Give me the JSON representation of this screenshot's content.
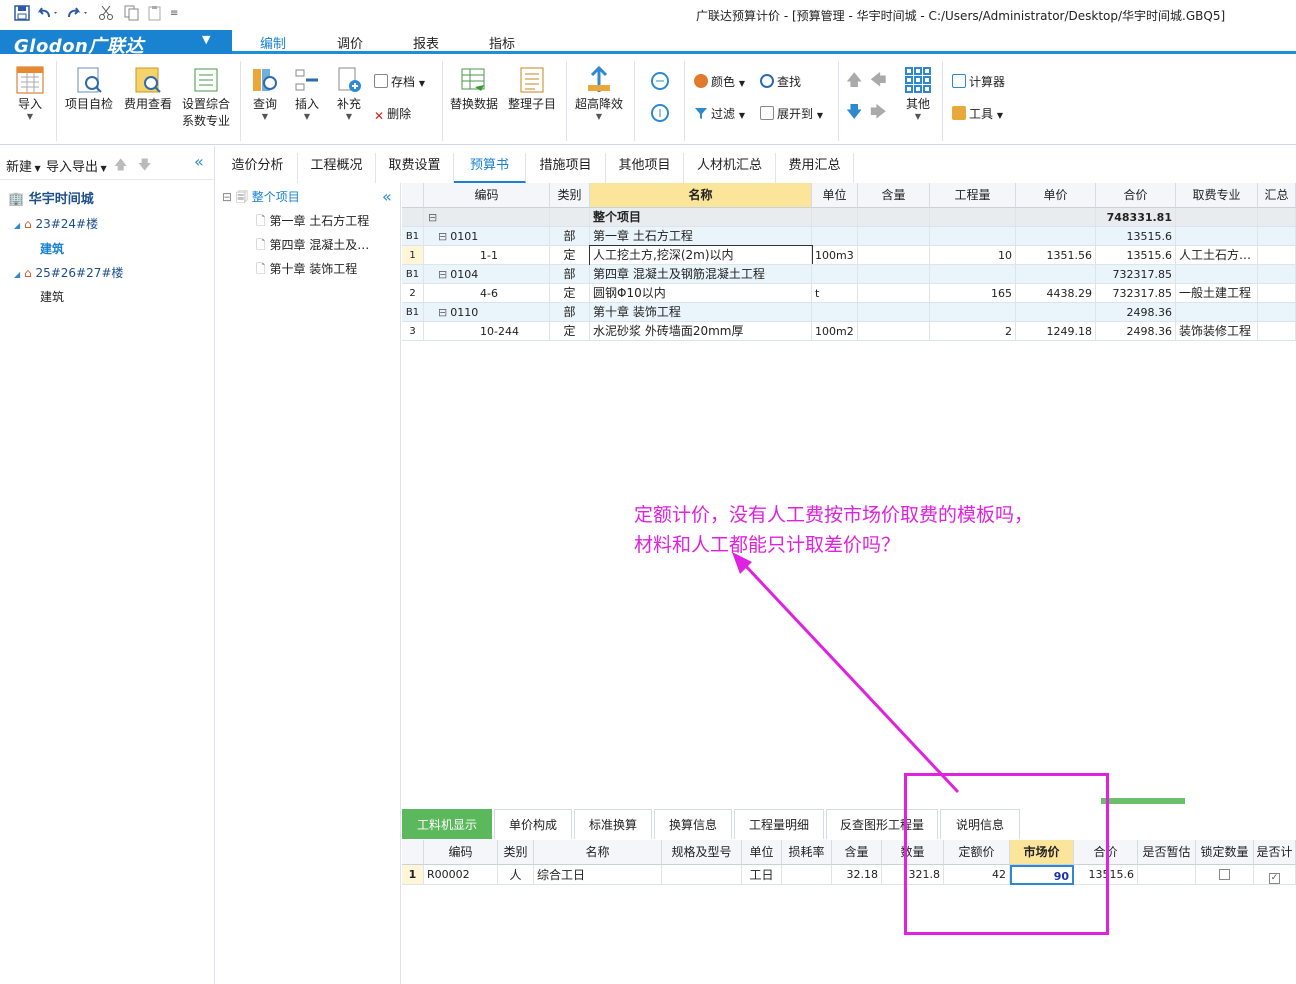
{
  "window": {
    "title": "广联达预算计价 - [预算管理 - 华宇时间城 - C:/Users/Administrator/Desktop/华宇时间城.GBQ5]"
  },
  "brand": {
    "logo": "Glodon广联达",
    "caret": "▼"
  },
  "menu": {
    "tabs": [
      "编制",
      "调价",
      "报表",
      "指标"
    ],
    "active": "编制"
  },
  "ribbon": {
    "import": "导入",
    "self_check": "项目自检",
    "fee_view": "费用查看",
    "set_coeff_line1": "设置综合",
    "set_coeff_line2": "系数专业",
    "query": "查询",
    "insert": "插入",
    "supplement": "补充",
    "save_file": "存档",
    "delete": "删除",
    "replace_data": "替换数据",
    "organize": "整理子目",
    "super_high": "超高降效",
    "color": "颜色",
    "find": "查找",
    "filter": "过滤",
    "expand_to": "展开到",
    "other": "其他",
    "calculator": "计算器",
    "tools": "工具"
  },
  "left": {
    "new": "新建",
    "import_export": "导入导出",
    "project": "华宇时间城",
    "buildings": [
      {
        "name": "23#24#楼",
        "child": "建筑"
      },
      {
        "name": "25#26#27#楼",
        "child": "建筑"
      }
    ]
  },
  "mid": {
    "root": "整个项目",
    "items": [
      "第一章 土石方工程",
      "第四章 混凝土及…",
      "第十章 装饰工程"
    ]
  },
  "content_tabs": [
    "造价分析",
    "工程概况",
    "取费设置",
    "预算书",
    "措施项目",
    "其他项目",
    "人材机汇总",
    "费用汇总"
  ],
  "content_tab_active": "预算书",
  "grid": {
    "headers": [
      "编码",
      "类别",
      "名称",
      "单位",
      "含量",
      "工程量",
      "单价",
      "合价",
      "取费专业",
      "汇总"
    ],
    "rows": [
      {
        "no": "",
        "code": "",
        "type": "",
        "name": "整个项目",
        "unit": "",
        "qty": "",
        "price": "",
        "total": "748331.81",
        "fee": "",
        "kind": "root"
      },
      {
        "no": "B1",
        "code": "0101",
        "type": "部",
        "name": "第一章 土石方工程",
        "unit": "",
        "qty": "",
        "price": "",
        "total": "13515.6",
        "fee": "",
        "kind": "part"
      },
      {
        "no": "1",
        "code": "1-1",
        "type": "定",
        "name": "人工挖土方,挖深(2m)以内",
        "unit": "100m3",
        "qty": "10",
        "price": "1351.56",
        "total": "13515.6",
        "fee": "人工土石方…",
        "kind": "item"
      },
      {
        "no": "B1",
        "code": "0104",
        "type": "部",
        "name": "第四章 混凝土及钢筋混凝土工程",
        "unit": "",
        "qty": "",
        "price": "",
        "total": "732317.85",
        "fee": "",
        "kind": "part"
      },
      {
        "no": "2",
        "code": "4-6",
        "type": "定",
        "name": "圆钢Φ10以内",
        "unit": "t",
        "qty": "165",
        "price": "4438.29",
        "total": "732317.85",
        "fee": "一般土建工程",
        "kind": "item"
      },
      {
        "no": "B1",
        "code": "0110",
        "type": "部",
        "name": "第十章 装饰工程",
        "unit": "",
        "qty": "",
        "price": "",
        "total": "2498.36",
        "fee": "",
        "kind": "part"
      },
      {
        "no": "3",
        "code": "10-244",
        "type": "定",
        "name": "水泥砂浆 外砖墙面20mm厚",
        "unit": "100m2",
        "qty": "2",
        "price": "1249.18",
        "total": "2498.36",
        "fee": "装饰装修工程",
        "kind": "item"
      }
    ]
  },
  "bottom_tabs": [
    "工料机显示",
    "单价构成",
    "标准换算",
    "换算信息",
    "工程量明细",
    "反查图形工程量",
    "说明信息"
  ],
  "bottom_tab_active": "工料机显示",
  "bottom_grid": {
    "headers": [
      "编码",
      "类别",
      "名称",
      "规格及型号",
      "单位",
      "损耗率",
      "含量",
      "数量",
      "定额价",
      "市场价",
      "合价",
      "是否暂估",
      "锁定数量",
      "是否计"
    ],
    "row": {
      "no": "1",
      "code": "R00002",
      "type": "人",
      "name": "综合工日",
      "spec": "",
      "unit": "工日",
      "loss": "",
      "content": "32.18",
      "qty": "321.8",
      "quota_price": "42",
      "market_price": "90",
      "total": "13515.6",
      "estimate": false,
      "lock_qty": false,
      "count": true
    }
  },
  "annotation": {
    "line1": "定额计价，没有人工费按市场价取费的模板吗，",
    "line2": "材料和人工都能只计取差价吗？",
    "color": "#e022e0"
  },
  "colors": {
    "accent": "#1a83d1",
    "green_tab": "#5cb85c",
    "annot": "#e022e0"
  }
}
